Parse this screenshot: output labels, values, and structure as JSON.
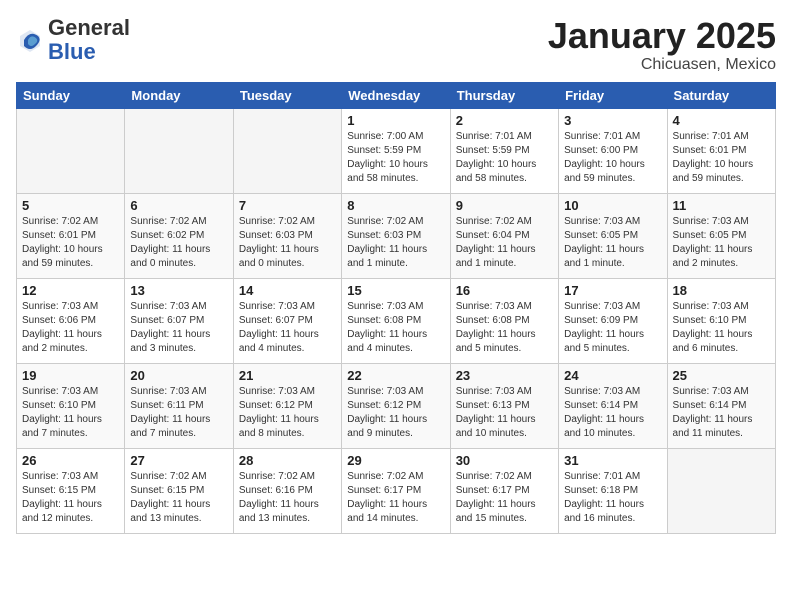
{
  "header": {
    "logo_general": "General",
    "logo_blue": "Blue",
    "month_title": "January 2025",
    "subtitle": "Chicuasen, Mexico"
  },
  "days_of_week": [
    "Sunday",
    "Monday",
    "Tuesday",
    "Wednesday",
    "Thursday",
    "Friday",
    "Saturday"
  ],
  "weeks": [
    [
      {
        "day": "",
        "info": ""
      },
      {
        "day": "",
        "info": ""
      },
      {
        "day": "",
        "info": ""
      },
      {
        "day": "1",
        "info": "Sunrise: 7:00 AM\nSunset: 5:59 PM\nDaylight: 10 hours\nand 58 minutes."
      },
      {
        "day": "2",
        "info": "Sunrise: 7:01 AM\nSunset: 5:59 PM\nDaylight: 10 hours\nand 58 minutes."
      },
      {
        "day": "3",
        "info": "Sunrise: 7:01 AM\nSunset: 6:00 PM\nDaylight: 10 hours\nand 59 minutes."
      },
      {
        "day": "4",
        "info": "Sunrise: 7:01 AM\nSunset: 6:01 PM\nDaylight: 10 hours\nand 59 minutes."
      }
    ],
    [
      {
        "day": "5",
        "info": "Sunrise: 7:02 AM\nSunset: 6:01 PM\nDaylight: 10 hours\nand 59 minutes."
      },
      {
        "day": "6",
        "info": "Sunrise: 7:02 AM\nSunset: 6:02 PM\nDaylight: 11 hours\nand 0 minutes."
      },
      {
        "day": "7",
        "info": "Sunrise: 7:02 AM\nSunset: 6:03 PM\nDaylight: 11 hours\nand 0 minutes."
      },
      {
        "day": "8",
        "info": "Sunrise: 7:02 AM\nSunset: 6:03 PM\nDaylight: 11 hours\nand 1 minute."
      },
      {
        "day": "9",
        "info": "Sunrise: 7:02 AM\nSunset: 6:04 PM\nDaylight: 11 hours\nand 1 minute."
      },
      {
        "day": "10",
        "info": "Sunrise: 7:03 AM\nSunset: 6:05 PM\nDaylight: 11 hours\nand 1 minute."
      },
      {
        "day": "11",
        "info": "Sunrise: 7:03 AM\nSunset: 6:05 PM\nDaylight: 11 hours\nand 2 minutes."
      }
    ],
    [
      {
        "day": "12",
        "info": "Sunrise: 7:03 AM\nSunset: 6:06 PM\nDaylight: 11 hours\nand 2 minutes."
      },
      {
        "day": "13",
        "info": "Sunrise: 7:03 AM\nSunset: 6:07 PM\nDaylight: 11 hours\nand 3 minutes."
      },
      {
        "day": "14",
        "info": "Sunrise: 7:03 AM\nSunset: 6:07 PM\nDaylight: 11 hours\nand 4 minutes."
      },
      {
        "day": "15",
        "info": "Sunrise: 7:03 AM\nSunset: 6:08 PM\nDaylight: 11 hours\nand 4 minutes."
      },
      {
        "day": "16",
        "info": "Sunrise: 7:03 AM\nSunset: 6:08 PM\nDaylight: 11 hours\nand 5 minutes."
      },
      {
        "day": "17",
        "info": "Sunrise: 7:03 AM\nSunset: 6:09 PM\nDaylight: 11 hours\nand 5 minutes."
      },
      {
        "day": "18",
        "info": "Sunrise: 7:03 AM\nSunset: 6:10 PM\nDaylight: 11 hours\nand 6 minutes."
      }
    ],
    [
      {
        "day": "19",
        "info": "Sunrise: 7:03 AM\nSunset: 6:10 PM\nDaylight: 11 hours\nand 7 minutes."
      },
      {
        "day": "20",
        "info": "Sunrise: 7:03 AM\nSunset: 6:11 PM\nDaylight: 11 hours\nand 7 minutes."
      },
      {
        "day": "21",
        "info": "Sunrise: 7:03 AM\nSunset: 6:12 PM\nDaylight: 11 hours\nand 8 minutes."
      },
      {
        "day": "22",
        "info": "Sunrise: 7:03 AM\nSunset: 6:12 PM\nDaylight: 11 hours\nand 9 minutes."
      },
      {
        "day": "23",
        "info": "Sunrise: 7:03 AM\nSunset: 6:13 PM\nDaylight: 11 hours\nand 10 minutes."
      },
      {
        "day": "24",
        "info": "Sunrise: 7:03 AM\nSunset: 6:14 PM\nDaylight: 11 hours\nand 10 minutes."
      },
      {
        "day": "25",
        "info": "Sunrise: 7:03 AM\nSunset: 6:14 PM\nDaylight: 11 hours\nand 11 minutes."
      }
    ],
    [
      {
        "day": "26",
        "info": "Sunrise: 7:03 AM\nSunset: 6:15 PM\nDaylight: 11 hours\nand 12 minutes."
      },
      {
        "day": "27",
        "info": "Sunrise: 7:02 AM\nSunset: 6:15 PM\nDaylight: 11 hours\nand 13 minutes."
      },
      {
        "day": "28",
        "info": "Sunrise: 7:02 AM\nSunset: 6:16 PM\nDaylight: 11 hours\nand 13 minutes."
      },
      {
        "day": "29",
        "info": "Sunrise: 7:02 AM\nSunset: 6:17 PM\nDaylight: 11 hours\nand 14 minutes."
      },
      {
        "day": "30",
        "info": "Sunrise: 7:02 AM\nSunset: 6:17 PM\nDaylight: 11 hours\nand 15 minutes."
      },
      {
        "day": "31",
        "info": "Sunrise: 7:01 AM\nSunset: 6:18 PM\nDaylight: 11 hours\nand 16 minutes."
      },
      {
        "day": "",
        "info": ""
      }
    ]
  ]
}
